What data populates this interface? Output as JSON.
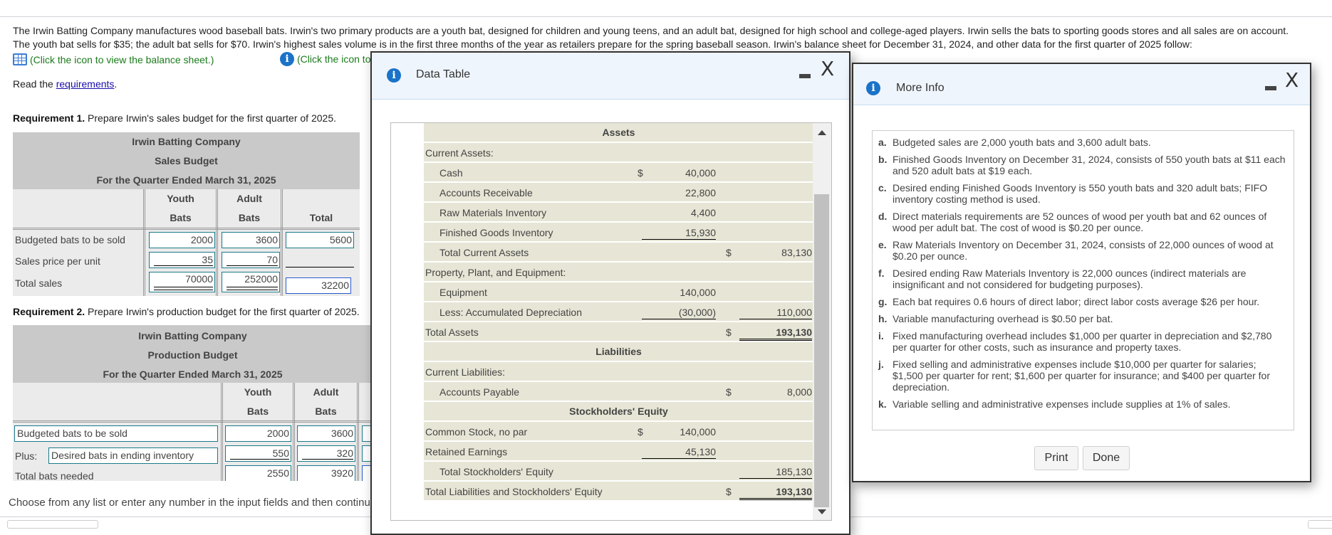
{
  "intro": {
    "line1": "The Irwin Batting Company manufactures wood baseball bats. Irwin's two primary products are a youth bat, designed for children and young teens, and an adult bat, designed for high school and college-aged players. Irwin sells the bats to sporting goods stores and all sales are on account.",
    "line2": "The youth bat sells for $35; the adult bat sells for $70. Irwin's highest sales volume is in the first three months of the year as retailers prepare for the spring baseball season. Irwin's balance sheet for December 31, 2024, and other data for the first quarter of 2025 follow:",
    "balance_link": "(Click the icon to view the balance sheet.)",
    "info_link": "(Click the icon to view additional information.)",
    "read_prefix": "Read the ",
    "read_link": "requirements",
    "read_suffix": "."
  },
  "req1": {
    "bold": "Requirement 1.",
    "text": " Prepare Irwin's sales budget for the first quarter of 2025.",
    "company": "Irwin Batting Company",
    "title": "Sales Budget",
    "period": "For the Quarter Ended March 31, 2025",
    "col_youth_1": "Youth",
    "col_youth_2": "Bats",
    "col_adult_1": "Adult",
    "col_adult_2": "Bats",
    "col_total": "Total",
    "rows": [
      {
        "label": "Budgeted bats to be sold",
        "youth": "2000",
        "adult": "3600",
        "total": "5600"
      },
      {
        "label": "Sales price per unit",
        "youth": "35",
        "adult": "70",
        "total": ""
      },
      {
        "label": "Total sales",
        "youth": "70000",
        "adult": "252000",
        "total": "32200"
      }
    ]
  },
  "req2": {
    "bold": "Requirement 2.",
    "text": " Prepare Irwin's production budget for the first quarter of 2025.",
    "company": "Irwin Batting Company",
    "title": "Production Budget",
    "period": "For the Quarter Ended March 31, 2025",
    "col_youth_1": "Youth",
    "col_youth_2": "Bats",
    "col_adult_1": "Adult",
    "col_adult_2": "Bats",
    "rows": [
      {
        "prefix": "",
        "label": "Budgeted bats to be sold",
        "youth": "2000",
        "adult": "3600"
      },
      {
        "prefix": "Plus:",
        "label": "Desired bats in ending inventory",
        "youth": "550",
        "adult": "320"
      },
      {
        "prefix": "",
        "label": "Total bats needed",
        "youth": "2550",
        "adult": "3920"
      }
    ]
  },
  "footer": {
    "message": "Choose from any list or enter any number in the input fields and then continue to the next question."
  },
  "data_table": {
    "title": "Data Table",
    "rows": [
      {
        "type": "section",
        "label": "Assets"
      },
      {
        "type": "line",
        "indent": 0,
        "label": "Current Assets:"
      },
      {
        "type": "line",
        "indent": 1,
        "label": "Cash",
        "d1": "$",
        "c1": "40,000"
      },
      {
        "type": "line",
        "indent": 1,
        "label": "Accounts Receivable",
        "c1": "22,800"
      },
      {
        "type": "line",
        "indent": 1,
        "label": "Raw Materials Inventory",
        "c1": "4,400"
      },
      {
        "type": "line",
        "indent": 1,
        "label": "Finished Goods Inventory",
        "c1": "15,930",
        "u1": true
      },
      {
        "type": "line",
        "indent": 1,
        "label": "Total Current Assets",
        "d2": "$",
        "c2": "83,130"
      },
      {
        "type": "line",
        "indent": 0,
        "label": "Property, Plant, and Equipment:"
      },
      {
        "type": "line",
        "indent": 1,
        "label": "Equipment",
        "c1": "140,000"
      },
      {
        "type": "line",
        "indent": 1,
        "label": "Less: Accumulated Depreciation",
        "c1": "(30,000)",
        "u1": true,
        "c2": "110,000",
        "u2": true
      },
      {
        "type": "line",
        "indent": 0,
        "label": "Total Assets",
        "d2": "$",
        "c2": "193,130",
        "bold2": true,
        "dbl2": true
      },
      {
        "type": "section",
        "label": "Liabilities"
      },
      {
        "type": "line",
        "indent": 0,
        "label": "Current Liabilities:"
      },
      {
        "type": "line",
        "indent": 1,
        "label": "Accounts Payable",
        "d2": "$",
        "c2": "8,000"
      },
      {
        "type": "section",
        "label": "Stockholders' Equity"
      },
      {
        "type": "line",
        "indent": 0,
        "label": "Common Stock, no par",
        "d1": "$",
        "c1": "140,000"
      },
      {
        "type": "line",
        "indent": 0,
        "label": "Retained Earnings",
        "c1": "45,130",
        "u1": true
      },
      {
        "type": "line",
        "indent": 1,
        "label": "Total Stockholders' Equity",
        "c2": "185,130",
        "u2": true
      },
      {
        "type": "line",
        "indent": 0,
        "label": "Total Liabilities and Stockholders' Equity",
        "d2": "$",
        "c2": "193,130",
        "bold2": true,
        "dbl2": true
      }
    ]
  },
  "more_info": {
    "title": "More Info",
    "items": [
      {
        "key": "a.",
        "text": "Budgeted sales are 2,000 youth bats and 3,600 adult bats."
      },
      {
        "key": "b.",
        "text": "Finished Goods Inventory on December 31, 2024, consists of 550 youth bats at $11 each and 520 adult bats at $19 each."
      },
      {
        "key": "c.",
        "text": "Desired ending Finished Goods Inventory is 550 youth bats and 320 adult bats; FIFO inventory costing method is used."
      },
      {
        "key": "d.",
        "text": "Direct materials requirements are 52 ounces of wood per youth bat and 62 ounces of wood per adult bat. The cost of wood is $0.20 per ounce."
      },
      {
        "key": "e.",
        "text": "Raw Materials Inventory on December 31, 2024, consists of 22,000 ounces of wood at $0.20 per ounce."
      },
      {
        "key": "f.",
        "text": "Desired ending Raw Materials Inventory is 22,000 ounces (indirect materials are insignificant and not considered for budgeting purposes)."
      },
      {
        "key": "g.",
        "text": "Each bat requires 0.6 hours of direct labor; direct labor costs average $26 per hour."
      },
      {
        "key": "h.",
        "text": "Variable manufacturing overhead is $0.50 per bat."
      },
      {
        "key": "i.",
        "text": "Fixed manufacturing overhead includes $1,000 per quarter in depreciation and $2,780 per quarter for other costs, such as insurance and property taxes."
      },
      {
        "key": "j.",
        "text": "Fixed selling and administrative expenses include $10,000 per quarter for salaries; $1,500 per quarter for rent; $1,600 per quarter for insurance; and $400 per quarter for depreciation."
      },
      {
        "key": "k.",
        "text": "Variable selling and administrative expenses include supplies at 1% of sales."
      }
    ],
    "print_label": "Print",
    "done_label": "Done"
  },
  "controls": {
    "close_glyph": "X"
  },
  "colors": {
    "link_green": "#1a7a1a",
    "info_blue": "#1a73c8",
    "input_border": "#1a7a8a",
    "table_bg": "#e7e5d5"
  }
}
